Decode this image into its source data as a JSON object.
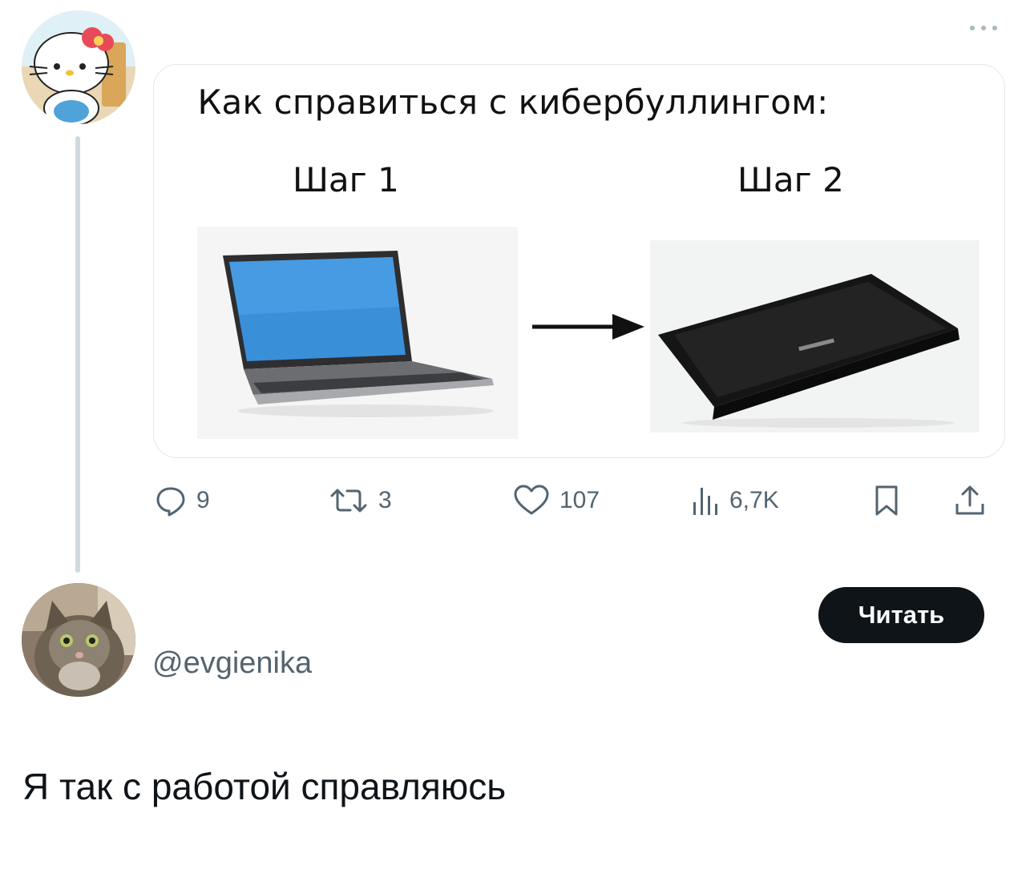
{
  "post": {
    "meme": {
      "title": "Как справиться с кибербуллингом:",
      "step1_label": "Шаг 1",
      "step2_label": "Шаг 2"
    },
    "actions": {
      "replies": "9",
      "retweets": "3",
      "likes": "107",
      "views": "6,7K"
    }
  },
  "reply": {
    "handle": "@evgienika",
    "follow_button_label": "Читать",
    "text": "Я так с работой справляюсь"
  },
  "icons": [
    "more-icon",
    "reply-icon",
    "retweet-icon",
    "like-icon",
    "views-icon",
    "bookmark-icon",
    "share-icon",
    "arrow-right-icon"
  ],
  "colors": {
    "text": "#0f1419",
    "secondary": "#536471",
    "border": "#e1e8ed",
    "button": "#0f1419"
  }
}
